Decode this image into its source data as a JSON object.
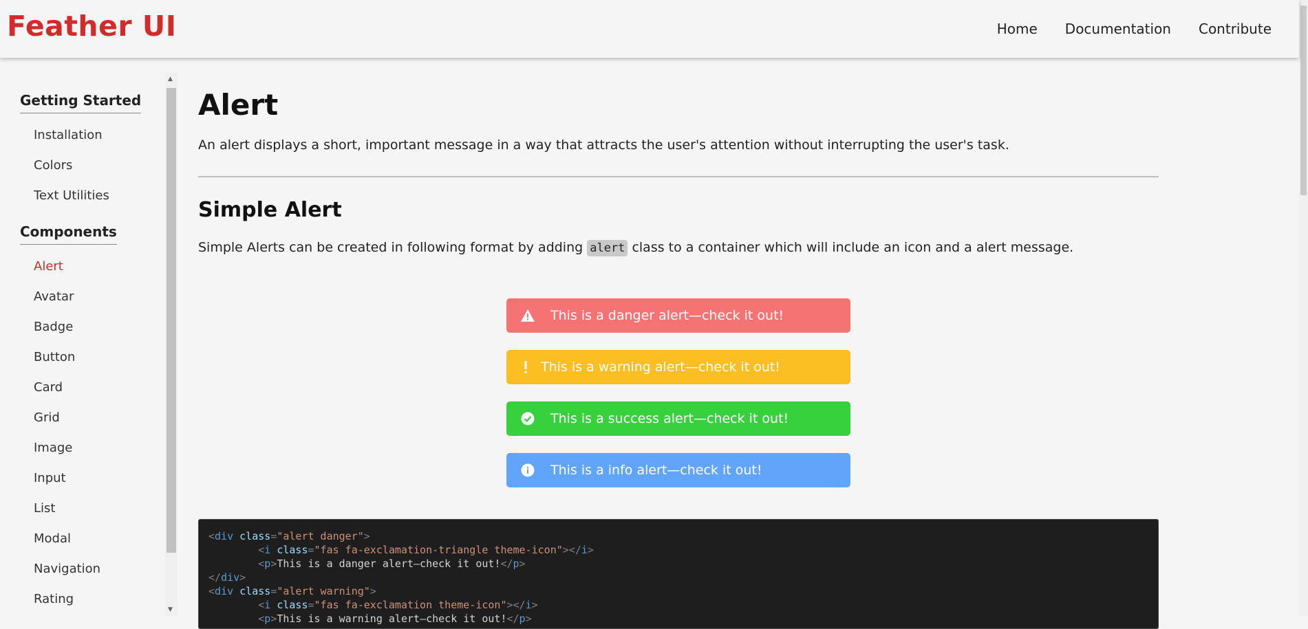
{
  "brand": "Feather UI",
  "nav": [
    "Home",
    "Documentation",
    "Contribute"
  ],
  "sidebar": {
    "sections": [
      {
        "title": "Getting Started",
        "items": [
          "Installation",
          "Colors",
          "Text Utilities"
        ]
      },
      {
        "title": "Components",
        "items": [
          "Alert",
          "Avatar",
          "Badge",
          "Button",
          "Card",
          "Grid",
          "Image",
          "Input",
          "List",
          "Modal",
          "Navigation",
          "Rating"
        ]
      }
    ],
    "active": "Alert"
  },
  "main": {
    "title": "Alert",
    "description": "An alert displays a short, important message in a way that attracts the user's attention without interrupting the user's task.",
    "section_title": "Simple Alert",
    "para_before": "Simple Alerts can be created in following format by adding ",
    "para_code": "alert",
    "para_after": " class to a container which will include an icon and a alert message."
  },
  "alerts": [
    {
      "type": "danger",
      "icon": "exclamation-triangle-icon",
      "text": "This is a danger alert—check it out!"
    },
    {
      "type": "warning",
      "icon": "exclamation-icon",
      "text": "This is a warning alert—check it out!"
    },
    {
      "type": "success",
      "icon": "check-circle-icon",
      "text": "This is a success alert—check it out!"
    },
    {
      "type": "info",
      "icon": "info-circle-icon",
      "text": "This is a info alert—check it out!"
    }
  ],
  "code": {
    "l1_tag": "div",
    "l1_attr": "class",
    "l1_val": "\"alert danger\"",
    "l2_tag": "i",
    "l2_attr": "class",
    "l2_val": "\"fas fa-exclamation-triangle theme-icon\"",
    "l2_close": "i",
    "l3_tag": "p",
    "l3_text": "This is a danger alert—check it out!",
    "l3_close": "p",
    "l4_close": "div",
    "l5_tag": "div",
    "l5_attr": "class",
    "l5_val": "\"alert warning\"",
    "l6_tag": "i",
    "l6_attr": "class",
    "l6_val": "\"fas fa-exclamation theme-icon\"",
    "l6_close": "i",
    "l7_tag": "p",
    "l7_text": "This is a warning alert—check it out!",
    "l7_close": "p"
  },
  "colors": {
    "brand": "#d12b2b",
    "danger": "#f57373",
    "warning": "#fbbf24",
    "success": "#36d13c",
    "info": "#60a5fa"
  }
}
